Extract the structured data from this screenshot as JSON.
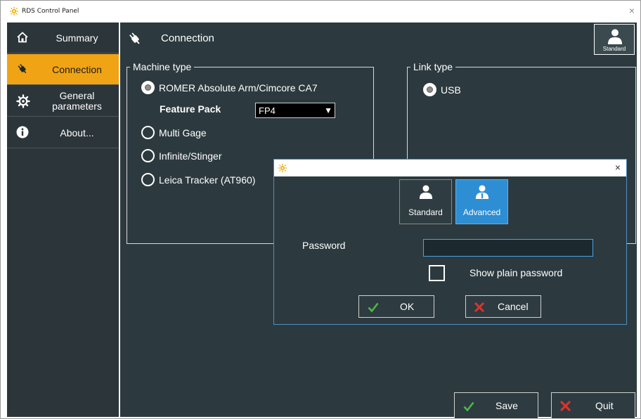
{
  "window": {
    "title": "RDS Control Panel",
    "close_glyph": "×"
  },
  "sidebar": {
    "items": [
      {
        "label": "Summary",
        "icon": "home-icon",
        "active": false
      },
      {
        "label": "Connection",
        "icon": "plug-icon",
        "active": true
      },
      {
        "label": "General\nparameters",
        "icon": "gear-icon",
        "active": false
      },
      {
        "label": "About...",
        "icon": "info-icon",
        "active": false
      }
    ]
  },
  "header": {
    "title": "Connection",
    "user_mode": "Standard"
  },
  "machine_type": {
    "legend": "Machine type",
    "options": [
      {
        "label": "ROMER Absolute Arm/Cimcore CA7",
        "checked": true
      },
      {
        "label": "Multi Gage",
        "checked": false
      },
      {
        "label": "Infinite/Stinger",
        "checked": false
      },
      {
        "label": "Leica Tracker (AT960)",
        "checked": false
      }
    ],
    "feature_pack": {
      "label": "Feature Pack",
      "value": "FP4",
      "arrow": "▼"
    }
  },
  "link_type": {
    "legend": "Link type",
    "options": [
      {
        "label": "USB",
        "checked": true
      }
    ]
  },
  "dialog": {
    "close_glyph": "×",
    "modes": [
      {
        "label": "Standard",
        "selected": false
      },
      {
        "label": "Advanced",
        "selected": true
      }
    ],
    "password_label": "Password",
    "password_value": "",
    "show_password_label": "Show plain password",
    "show_password_checked": false,
    "ok_label": "OK",
    "cancel_label": "Cancel"
  },
  "footer": {
    "save_label": "Save",
    "quit_label": "Quit"
  },
  "colors": {
    "accent": "#f0a314",
    "panel_bg": "#2c3a3f",
    "sidebar_bg": "#2c3539",
    "selected_blue": "#2d8ed3",
    "ok_green": "#4cb848",
    "cancel_red": "#d9342b"
  }
}
